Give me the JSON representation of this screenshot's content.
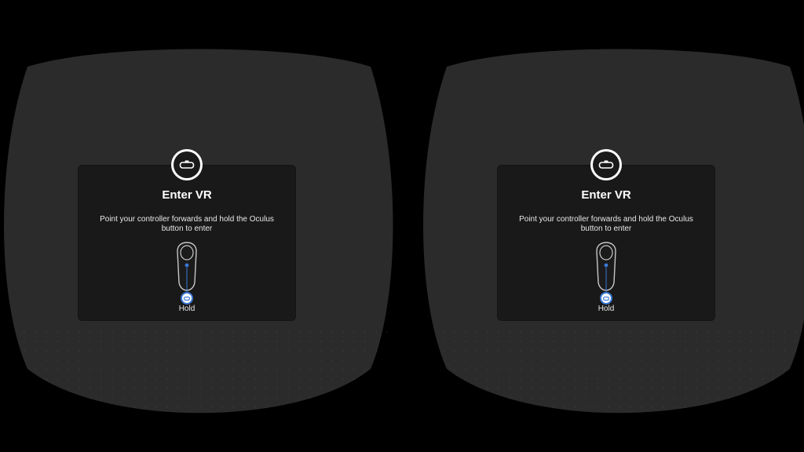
{
  "dialog": {
    "title": "Enter VR",
    "instruction": "Point your controller forwards and hold the Oculus button to enter",
    "hold_label": "Hold"
  },
  "icons": {
    "header": "headset-icon",
    "controller": "controller-icon",
    "button": "oculus-button-icon"
  },
  "colors": {
    "background": "#000000",
    "lens": "#2b2b2b",
    "panel": "#191919",
    "text": "#ffffff",
    "accent": "#3a78d6"
  }
}
